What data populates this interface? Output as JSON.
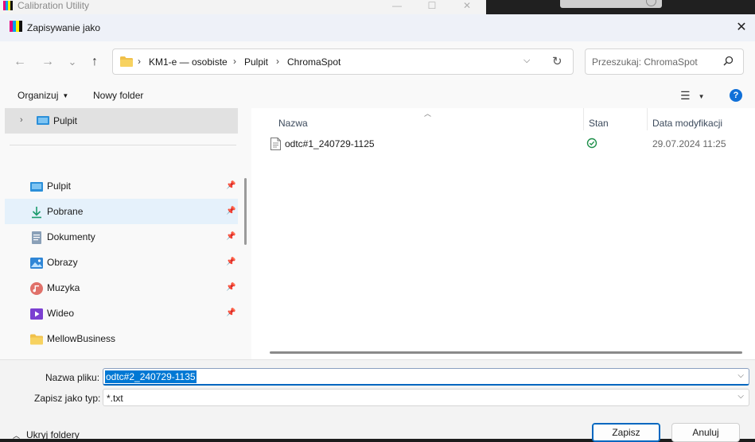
{
  "background_app": {
    "title": "Calibration Utility"
  },
  "dialog": {
    "title": "Zapisywanie jako",
    "close_glyph": "✕"
  },
  "navigation": {
    "back_glyph": "←",
    "forward_glyph": "→",
    "recent_glyph": "⌄",
    "up_glyph": "↑",
    "breadcrumb": [
      "KM1-e — osobiste",
      "Pulpit",
      "ChromaSpot"
    ],
    "search_placeholder": "Przeszukaj: ChromaSpot"
  },
  "toolbar": {
    "organize_label": "Organizuj",
    "new_folder_label": "Nowy folder",
    "help_glyph": "?"
  },
  "nav_pane": {
    "tree_top": "Pulpit",
    "items": [
      {
        "label": "Pulpit",
        "icon": "desktop-icon",
        "pinned": true,
        "selected": false
      },
      {
        "label": "Pobrane",
        "icon": "download-icon",
        "pinned": true,
        "selected": true
      },
      {
        "label": "Dokumenty",
        "icon": "documents-icon",
        "pinned": true,
        "selected": false
      },
      {
        "label": "Obrazy",
        "icon": "pictures-icon",
        "pinned": true,
        "selected": false
      },
      {
        "label": "Muzyka",
        "icon": "music-icon",
        "pinned": true,
        "selected": false
      },
      {
        "label": "Wideo",
        "icon": "video-icon",
        "pinned": true,
        "selected": false
      },
      {
        "label": "MellowBusiness",
        "icon": "folder-icon",
        "pinned": false,
        "selected": false
      }
    ]
  },
  "file_list": {
    "columns": [
      "Nazwa",
      "Stan",
      "Data modyfikacji"
    ],
    "rows": [
      {
        "name": "odtc#1_240729-1125",
        "status": "synced",
        "modified": "29.07.2024 11:25"
      }
    ]
  },
  "save_form": {
    "filename_label": "Nazwa pliku:",
    "filename_value": "odtc#2_240729-1135",
    "type_label": "Zapisz jako typ:",
    "type_value": "*.txt"
  },
  "footer": {
    "hide_folders_label": "Ukryj foldery",
    "save_label": "Zapisz",
    "cancel_label": "Anuluj"
  },
  "colors": {
    "accent": "#0067c0",
    "selection": "#e5f1fb",
    "status_ok": "#1e8f4a"
  }
}
